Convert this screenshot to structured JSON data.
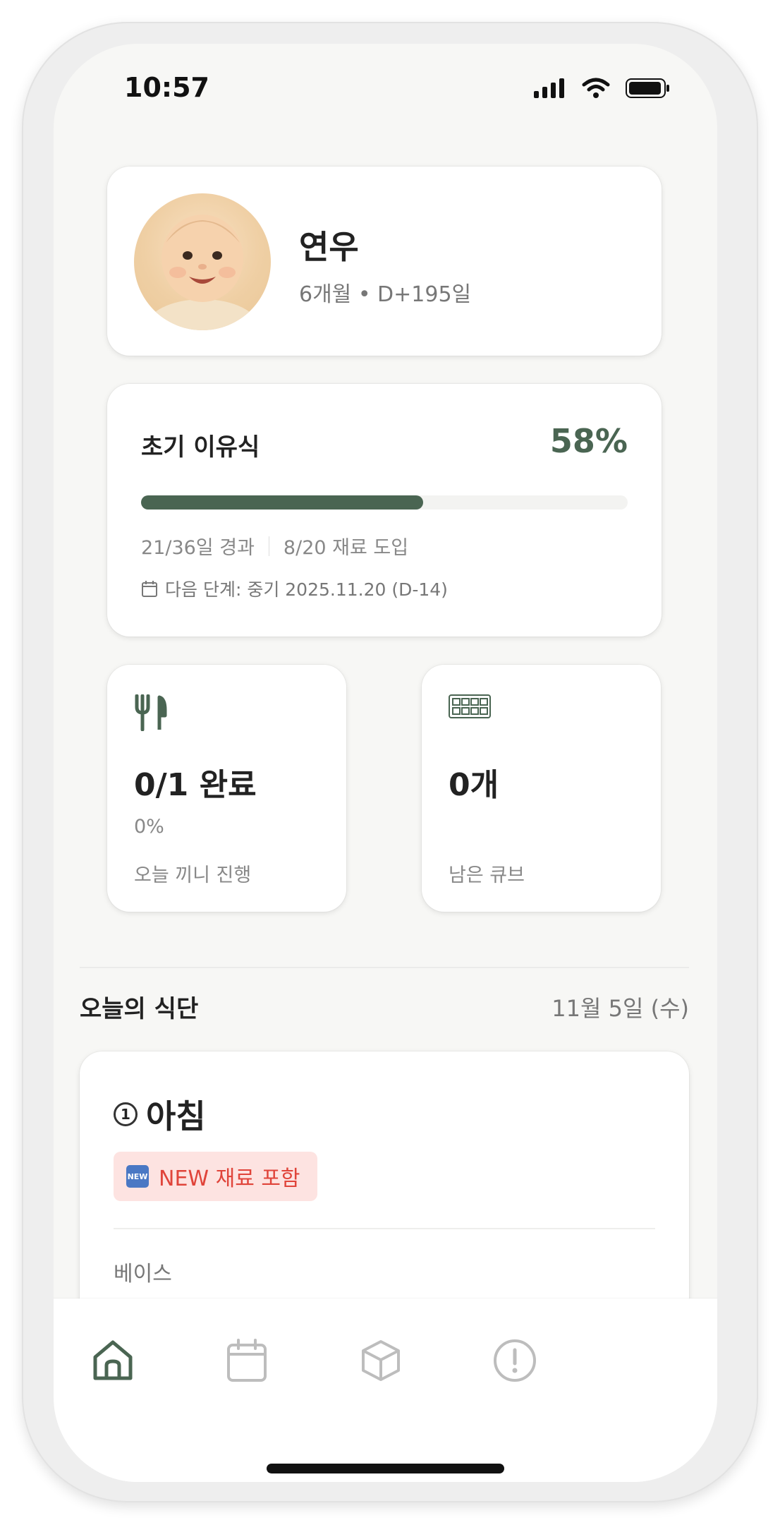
{
  "status_bar": {
    "time": "10:57"
  },
  "profile": {
    "name": "연우",
    "age": "6개월 • D+195일"
  },
  "stage": {
    "title": "초기 이유식",
    "percent_label": "58%",
    "progress": 0.58,
    "days": "21/36일 경과",
    "ingredients": "8/20 재료 도입",
    "next": "다음 단계: 중기 2025.11.20 (D-14)"
  },
  "meals_summary": {
    "value": "0/1 완료",
    "percent": "0%",
    "label": "오늘 끼니 진행",
    "icon": "utensils-icon"
  },
  "cubes_summary": {
    "value": "0개",
    "label": "남은 큐브",
    "icon": "ice-cube-tray-icon"
  },
  "today": {
    "title": "오늘의 식단",
    "date": "11월 5일 (수)",
    "meal": {
      "number": "1",
      "name": "아침",
      "badge_icon": "NEW",
      "badge": "NEW 재료 포함",
      "sub_label": "베이스"
    }
  },
  "tabs": [
    {
      "icon": "home-icon",
      "active": true
    },
    {
      "icon": "calendar-icon",
      "active": false
    },
    {
      "icon": "box-icon",
      "active": false
    },
    {
      "icon": "alert-icon",
      "active": false
    }
  ],
  "colors": {
    "accent": "#4a6552",
    "badge_bg": "#fde3e1",
    "badge_text": "#e0443a"
  }
}
